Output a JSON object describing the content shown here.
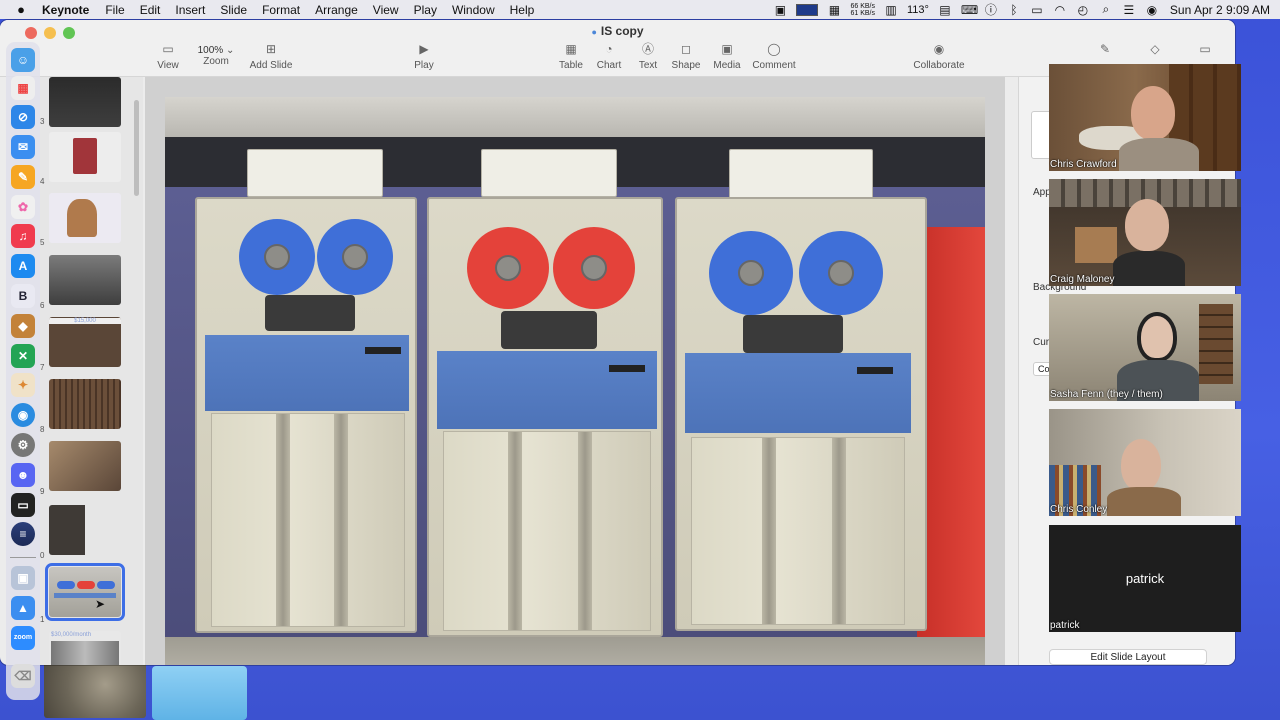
{
  "menubar": {
    "app_name": "Keynote",
    "menus": [
      "File",
      "Edit",
      "Insert",
      "Slide",
      "Format",
      "Arrange",
      "View",
      "Play",
      "Window",
      "Help"
    ],
    "net_up": "66 KB/s",
    "net_down": "61 KB/s",
    "temperature": "113°",
    "clock": "Sun Apr 2  9:09 AM"
  },
  "window": {
    "title": "IS copy",
    "toolbar": {
      "view": "View",
      "zoom_value": "100%",
      "zoom": "Zoom",
      "add_slide": "Add Slide",
      "play": "Play",
      "table": "Table",
      "chart": "Chart",
      "text": "Text",
      "shape": "Shape",
      "media": "Media",
      "comment": "Comment",
      "collaborate": "Collaborate"
    }
  },
  "navigator": {
    "numbers": [
      "3",
      "4",
      "5",
      "6",
      "7",
      "8",
      "9",
      "0",
      "1"
    ],
    "slide_labels": [
      "$15,000",
      "$30,000/month"
    ]
  },
  "inspector": {
    "appearance_label": "App",
    "background_label": "Background",
    "current_label": "Curr",
    "field_value": "Co",
    "edit_layout_button": "Edit Slide Layout"
  },
  "zoom_participants": [
    {
      "name": "Chris Crawford"
    },
    {
      "name": "Craig Maloney"
    },
    {
      "name": "Sasha Fenn (they / them)"
    },
    {
      "name": "Chris Conley"
    },
    {
      "name": "patrick",
      "center_label": "patrick"
    }
  ],
  "dock": {
    "zoom_label": "zoom",
    "b_label": "B"
  },
  "colors": {
    "desktop": "#3f55d6",
    "selection": "#3d6ee6",
    "reel_blue": "#3f6fd8",
    "reel_red": "#e4423a",
    "cabinet_band": "#5a82c8"
  }
}
